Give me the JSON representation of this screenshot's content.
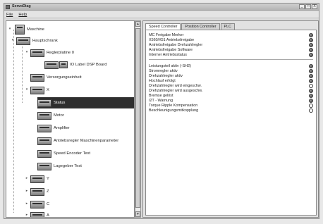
{
  "window": {
    "title": "ServoDiag"
  },
  "window_controls": {
    "minimize": "_",
    "maximize": "□",
    "close": "X"
  },
  "menu": [
    {
      "label": "File"
    },
    {
      "label": "Help"
    }
  ],
  "tree": {
    "items": [
      {
        "label": "Maschine"
      },
      {
        "label": "Hauptschrank"
      },
      {
        "label": "Reglerplatine 0"
      },
      {
        "label": "IO Label DSP Board"
      },
      {
        "label": "Versorgungseinheit"
      },
      {
        "label": "X"
      },
      {
        "label": "Status",
        "selected": true
      },
      {
        "label": "Motor"
      },
      {
        "label": "Amplifier"
      },
      {
        "label": "Antriebsregler Maschinenparameter"
      },
      {
        "label": "Speed Encoder Test"
      },
      {
        "label": "Lagegeber Test"
      },
      {
        "label": "Y"
      },
      {
        "label": "Z"
      },
      {
        "label": "C"
      },
      {
        "label": "A"
      }
    ]
  },
  "tabs": [
    {
      "label": "Speed Controller",
      "active": true
    },
    {
      "label": "Position Controller",
      "active": false
    },
    {
      "label": "PLC",
      "active": false
    }
  ],
  "signals_group1": [
    {
      "label": "MC Freigabe Merker",
      "state": "on"
    },
    {
      "label": "X560/X51 Antriebsfreigabe",
      "state": "on"
    },
    {
      "label": "Antriebsfreigabe Drehzahlregler",
      "state": "on"
    },
    {
      "label": "Antriebsfreigabe Software",
      "state": "on"
    },
    {
      "label": "Interner Antriebsstatus",
      "state": "on"
    }
  ],
  "signals_group2": [
    {
      "label": "Leistungsteil aktiv (-SH2)",
      "state": "on"
    },
    {
      "label": "Stromregler aktiv",
      "state": "on"
    },
    {
      "label": "Drehzahlregler aktiv",
      "state": "on"
    },
    {
      "label": "Hochlauf erfolgt",
      "state": "on"
    },
    {
      "label": "Drehzahlregler wird eingeschw.",
      "state": "off"
    },
    {
      "label": "Drehzahlregler wird ausgeschw.",
      "state": "on"
    },
    {
      "label": "Bremse gelöst",
      "state": "on"
    },
    {
      "label": "I2T - Warnung",
      "state": "on"
    },
    {
      "label": "Torque Ripple Kompensation",
      "state": "off"
    },
    {
      "label": "Beschleunigungsmitkopplung",
      "state": "off"
    }
  ]
}
